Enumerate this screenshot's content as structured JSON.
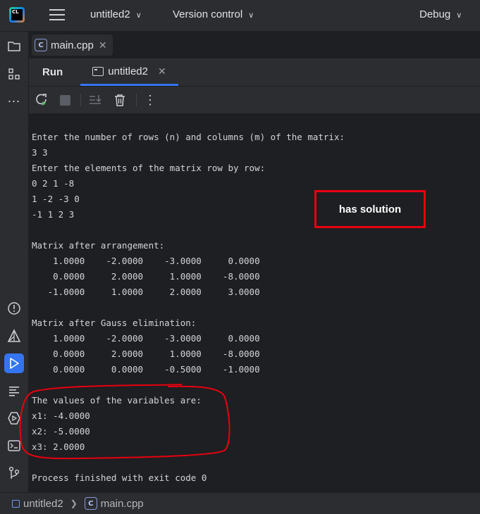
{
  "titlebar": {
    "logo_text": "CL",
    "project": "untitled2",
    "vcs": "Version control",
    "run_config": "Debug"
  },
  "file_tab": {
    "name": "main.cpp",
    "icon_text": "C"
  },
  "tool_window": {
    "title": "Run",
    "tab_label": "untitled2"
  },
  "console": {
    "lines": [
      "Enter the number of rows (n) and columns (m) of the matrix:",
      "3 3",
      "Enter the elements of the matrix row by row:",
      "0 2 1 -8",
      "1 -2 -3 0",
      "-1 1 2 3",
      "",
      "Matrix after arrangement:",
      "    1.0000    -2.0000    -3.0000     0.0000",
      "    0.0000     2.0000     1.0000    -8.0000",
      "   -1.0000     1.0000     2.0000     3.0000",
      "",
      "Matrix after Gauss elimination:",
      "    1.0000    -2.0000    -3.0000     0.0000",
      "    0.0000     2.0000     1.0000    -8.0000",
      "    0.0000     0.0000    -0.5000    -1.0000",
      "",
      "The values of the variables are:",
      "x1: -4.0000",
      "x2: -5.0000",
      "x3: 2.0000",
      "",
      "Process finished with exit code 0"
    ]
  },
  "annotation": {
    "label": "has solution",
    "color": "#e8000f"
  },
  "statusbar": {
    "project": "untitled2",
    "file": "main.cpp"
  },
  "colors": {
    "accent": "#3574f0",
    "background": "#1e1f22",
    "panel": "#2b2d30"
  }
}
